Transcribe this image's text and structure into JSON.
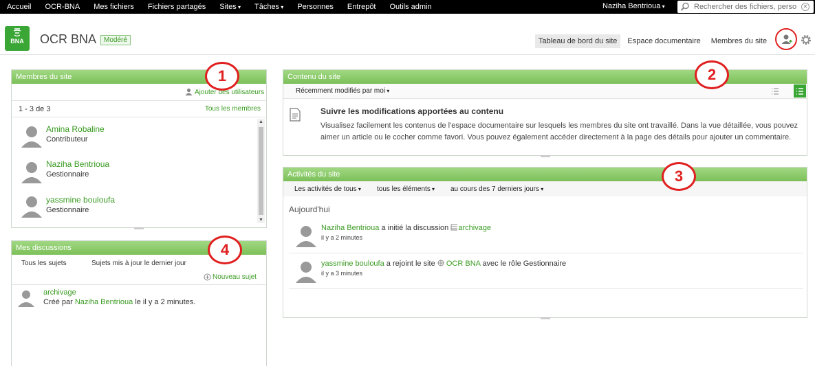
{
  "topbar": {
    "nav": [
      {
        "label": "Accueil",
        "caret": false
      },
      {
        "label": "OCR-BNA",
        "caret": false
      },
      {
        "label": "Mes fichiers",
        "caret": false
      },
      {
        "label": "Fichiers partagés",
        "caret": false
      },
      {
        "label": "Sites",
        "caret": true
      },
      {
        "label": "Tâches",
        "caret": true
      },
      {
        "label": "Personnes",
        "caret": false
      },
      {
        "label": "Entrepôt",
        "caret": false
      },
      {
        "label": "Outils admin",
        "caret": false
      }
    ],
    "user": "Naziha Bentrioua",
    "search_placeholder": "Rechercher des fichiers, perso"
  },
  "header": {
    "logo_text": "BNA",
    "site_title": "OCR BNA",
    "badge": "Modéré",
    "nav": [
      "Tableau de bord du site",
      "Espace documentaire",
      "Membres du site"
    ]
  },
  "members": {
    "title": "Membres du site",
    "add_label": "Ajouter des utilisateurs",
    "count": "1 - 3 de 3",
    "all_link": "Tous les membres",
    "items": [
      {
        "name": "Amina Robaline",
        "role": "Contributeur"
      },
      {
        "name": "Naziha Bentrioua",
        "role": "Gestionnaire"
      },
      {
        "name": "yassmine bouloufa",
        "role": "Gestionnaire"
      }
    ]
  },
  "content": {
    "title": "Contenu du site",
    "filter": "Récemment modifiés par moi",
    "heading": "Suivre les modifications apportées au contenu",
    "body": "Visualisez facilement les contenus de l'espace documentaire sur lesquels les membres du site ont travaillé. Dans la vue détaillée, vous pouvez aimer un article ou le cocher comme favori. Vous pouvez également accéder directement à la page des détails pour ajouter un commentaire."
  },
  "activities": {
    "title": "Activités du site",
    "filters": [
      "Les activités de tous",
      "tous les éléments",
      "au cours des 7 derniers jours"
    ],
    "day": "Aujourd'hui",
    "items": [
      {
        "user": "Naziha Bentrioua",
        "action": "a initié la discussion",
        "target": "archivage",
        "suffix": "",
        "time": "il y a 2 minutes"
      },
      {
        "user": "yassmine bouloufa",
        "action": "a rejoint le site",
        "target": "OCR BNA",
        "suffix": "avec le rôle Gestionnaire",
        "time": "il y a 3 minutes"
      }
    ]
  },
  "discussions": {
    "title": "Mes discussions",
    "filters": [
      "Tous les sujets",
      "Sujets mis à jour le dernier jour"
    ],
    "new_topic": "Nouveau sujet",
    "items": [
      {
        "title": "archivage",
        "created_by_prefix": "Créé par",
        "author": "Naziha Bentrioua",
        "created_suffix": "le il y a 2 minutes."
      }
    ]
  },
  "annotations": [
    "1",
    "2",
    "3",
    "4"
  ],
  "colors": {
    "accent": "#3a9b22",
    "header_green": "#8dcb6a",
    "annotation": "#e02020"
  }
}
